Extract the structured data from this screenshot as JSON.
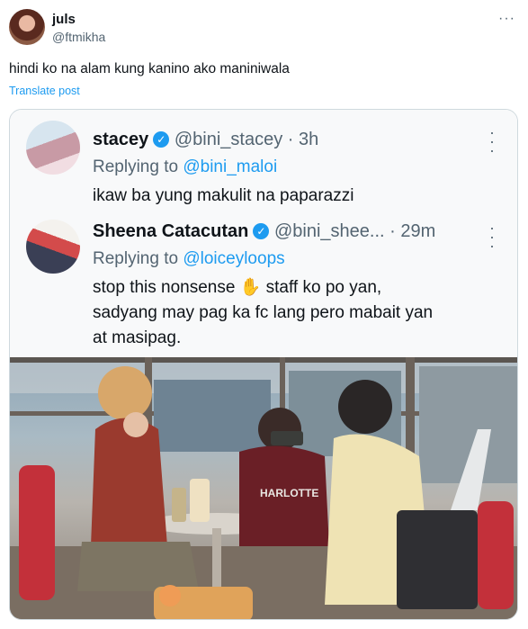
{
  "tweet": {
    "author_name": "juls",
    "author_handle": "@ftmikha",
    "text": "hindi ko na alam kung kanino ako maniniwala",
    "translate_label": "Translate post",
    "more_icon": "more-icon"
  },
  "screenshot": {
    "reply1": {
      "name": "stacey",
      "handle_time": "@bini_stacey · 3h",
      "replying_prefix": "Replying to",
      "replying_to": "@bini_maloi",
      "text": "ikaw ba yung makulit na paparazzi"
    },
    "reply2": {
      "name": "Sheena Catacutan",
      "handle_time": "@bini_shee... · 29m",
      "replying_prefix": "Replying to",
      "replying_to": "@loiceyloops",
      "text_lines": [
        "stop this nonsense ✋ staff ko po yan,",
        "sadyang may pag ka fc lang pero mabait yan",
        "at masipag."
      ]
    },
    "photo_shirt_text": "HARLOTTE"
  },
  "colors": {
    "accent": "#1d9bf0",
    "text": "#0f1419",
    "muted": "#536471",
    "border": "#cfd9de"
  }
}
